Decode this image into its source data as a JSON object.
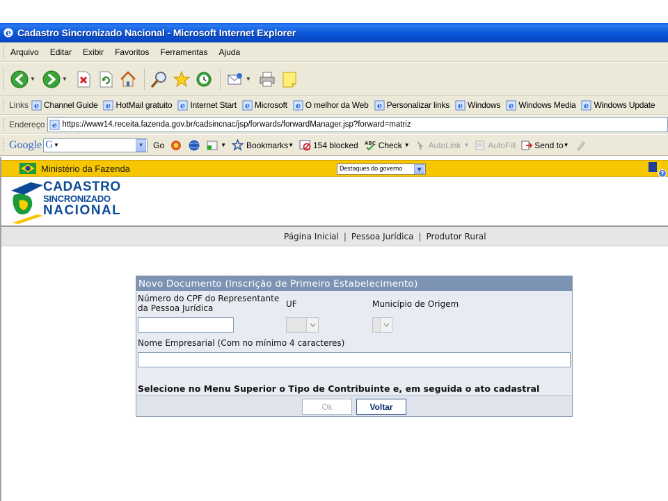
{
  "window": {
    "title": "Cadastro Sincronizado Nacional - Microsoft Internet Explorer"
  },
  "menu": [
    "Arquivo",
    "Editar",
    "Exibir",
    "Favoritos",
    "Ferramentas",
    "Ajuda"
  ],
  "links_bar": {
    "label": "Links",
    "items": [
      "Channel Guide",
      "HotMail gratuito",
      "Internet Start",
      "Microsoft",
      "O melhor da Web",
      "Personalizar links",
      "Windows",
      "Windows Media",
      "Windows Update"
    ]
  },
  "address_bar": {
    "label": "Endereço",
    "url": "https://www14.receita.fazenda.gov.br/cadsincnac/jsp/forwards/forwardManager.jsp?forward=matriz"
  },
  "google_toolbar": {
    "logo": "Google",
    "go_label": "Go",
    "bookmarks_label": "Bookmarks",
    "blocked_label": "154 blocked",
    "check_label": "Check",
    "autolink_label": "AutoLink",
    "autofill_label": "AutoFill",
    "sendto_label": "Send to"
  },
  "site": {
    "ministry": "Ministério da Fazenda",
    "gov_select": "Destaques do governo",
    "logo_lines": [
      "CADASTRO",
      "SINCRONIZADO",
      "NACIONAL"
    ],
    "nav": [
      "Página Inicial",
      "Pessoa Jurídica",
      "Produtor Rural"
    ]
  },
  "form": {
    "title": "Novo Documento (Inscrição de Primeiro Estabelecimento)",
    "cpf_label_1": "Número do CPF do Representante",
    "cpf_label_2": "da Pessoa Jurídica",
    "uf_label": "UF",
    "municipio_label": "Município de Origem",
    "nome_label": "Nome Empresarial  (Com no mínimo 4 caracteres)",
    "instruction": "Selecione no Menu Superior o Tipo de Contribuinte e, em seguida o ato cadastral desejado.",
    "ok_label": "Ok",
    "voltar_label": "Voltar"
  }
}
